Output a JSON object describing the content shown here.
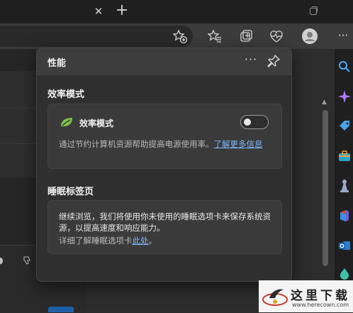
{
  "browser": {
    "tab_close_glyph": "✕",
    "new_tab_glyph": "+"
  },
  "toolbar": {
    "icons": [
      "add-favorite-icon",
      "favorites-icon",
      "collections-icon",
      "performance-icon",
      "profile-icon",
      "more-icon"
    ],
    "more_glyph": "···"
  },
  "sidebar": {
    "icons": [
      "search-icon",
      "copilot-icon",
      "shopping-icon",
      "tools-icon",
      "games-icon",
      "office-icon",
      "outlook-icon",
      "drop-icon"
    ]
  },
  "popup": {
    "title": "性能",
    "more_glyph": "···",
    "efficiency": {
      "section_title": "效率模式",
      "label": "效率模式",
      "toggle_on": false,
      "desc_prefix": "通过节约计算机资源帮助提高电源使用率。",
      "desc_link": "了解更多信息"
    },
    "sleeping_tabs": {
      "section_title": "睡眠标签页",
      "desc": "继续浏览，我们将使用你未使用的睡眠选项卡来保存系统资源，以提高速度和响应能力。",
      "more_prefix": "详细了解睡眠选项卡",
      "more_link": "此处",
      "more_suffix": "。"
    }
  },
  "watermark": {
    "title": "这里下载",
    "site": "www.herecown.com"
  },
  "colors": {
    "accent_link": "#7cb8ff",
    "leaf_green": "#7ec24a",
    "sidebar_search": "#4ea6ff",
    "copilot": "#a77bff"
  }
}
